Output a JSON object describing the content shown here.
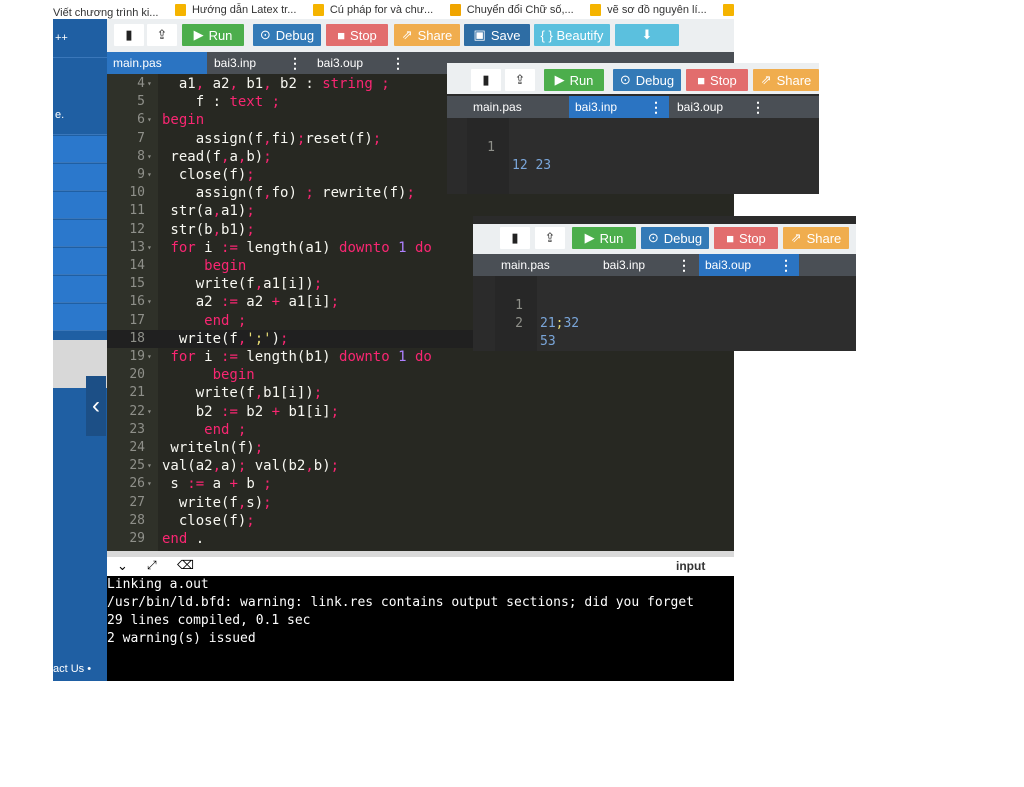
{
  "bookmarks": [
    {
      "label": "Viết chương trình ki...",
      "color": "#ffffff"
    },
    {
      "label": "Hướng dẫn Latex tr...",
      "color": "#f5b400"
    },
    {
      "label": "Cú pháp for và chư...",
      "color": "#f5b400"
    },
    {
      "label": "Chuyển đổi Chữ số,...",
      "color": "#f0a500"
    },
    {
      "label": "vẽ sơ đồ nguyên lí...",
      "color": "#f5b400"
    }
  ],
  "sidebar": {
    "items": [
      "++",
      "e.",
      "",
      "",
      "",
      "",
      "",
      "",
      ""
    ],
    "footer": "act Us •"
  },
  "toolbar": {
    "run": "Run",
    "debug": "Debug",
    "stop": "Stop",
    "share": "Share",
    "save": "Save",
    "beautify": "{ } Beautify"
  },
  "tabs": [
    {
      "label": "main.pas",
      "active": true
    },
    {
      "label": "bai3.inp",
      "active": false
    },
    {
      "label": "bai3.oup",
      "active": false
    }
  ],
  "editor": {
    "lines": [
      {
        "n": "4",
        "fold": true
      },
      {
        "n": "5",
        "fold": false
      },
      {
        "n": "6",
        "fold": true
      },
      {
        "n": "7",
        "fold": false
      },
      {
        "n": "8",
        "fold": true
      },
      {
        "n": "9",
        "fold": true
      },
      {
        "n": "10",
        "fold": false
      },
      {
        "n": "11",
        "fold": false
      },
      {
        "n": "12",
        "fold": false
      },
      {
        "n": "13",
        "fold": true
      },
      {
        "n": "14",
        "fold": false
      },
      {
        "n": "15",
        "fold": false
      },
      {
        "n": "16",
        "fold": true
      },
      {
        "n": "17",
        "fold": false
      },
      {
        "n": "18",
        "fold": false
      },
      {
        "n": "19",
        "fold": true
      },
      {
        "n": "20",
        "fold": false
      },
      {
        "n": "21",
        "fold": false
      },
      {
        "n": "22",
        "fold": true
      },
      {
        "n": "23",
        "fold": false
      },
      {
        "n": "24",
        "fold": false
      },
      {
        "n": "25",
        "fold": true
      },
      {
        "n": "26",
        "fold": true
      },
      {
        "n": "27",
        "fold": false
      },
      {
        "n": "28",
        "fold": false
      },
      {
        "n": "29",
        "fold": false
      }
    ],
    "code": [
      "  a1, a2, b1, b2 : string ;",
      "    f : text ;",
      "begin",
      "    assign(f,fi);reset(f);",
      " read(f,a,b);",
      "  close(f);",
      "    assign(f,fo) ; rewrite(f);",
      " str(a,a1);",
      " str(b,b1);",
      " for i := length(a1) downto 1 do",
      "     begin",
      "    write(f,a1[i]);",
      "    a2 := a2 + a1[i];",
      "     end ;",
      "  write(f,';');",
      " for i := length(b1) downto 1 do",
      "      begin",
      "    write(f,b1[i]);",
      "    b2 := b2 + b1[i];",
      "     end ;",
      " writeln(f);",
      "val(a2,a); val(b2,b);",
      " s := a + b ;",
      "  write(f,s);",
      "  close(f);",
      "end ."
    ]
  },
  "io_bar": {
    "label": "input"
  },
  "console": [
    "Linking a.out",
    "/usr/bin/ld.bfd: warning: link.res contains output sections; did you forget",
    "29 lines compiled, 0.1 sec",
    "2 warning(s) issued"
  ],
  "overlay_inp": {
    "toolbar": {
      "run": "Run",
      "debug": "Debug",
      "stop": "Stop",
      "share": "Share"
    },
    "tabs": [
      "main.pas",
      "bai3.inp",
      "bai3.oup"
    ],
    "line_number": "1",
    "content": "12 23"
  },
  "overlay_oup": {
    "toolbar": {
      "run": "Run",
      "debug": "Debug",
      "stop": "Stop",
      "share": "Share"
    },
    "tabs": [
      "main.pas",
      "bai3.inp",
      "bai3.oup"
    ],
    "lines": [
      {
        "n": "1",
        "a": "21",
        "sep": ";",
        "b": "32"
      },
      {
        "n": "2",
        "a": "53",
        "sep": "",
        "b": ""
      }
    ]
  }
}
